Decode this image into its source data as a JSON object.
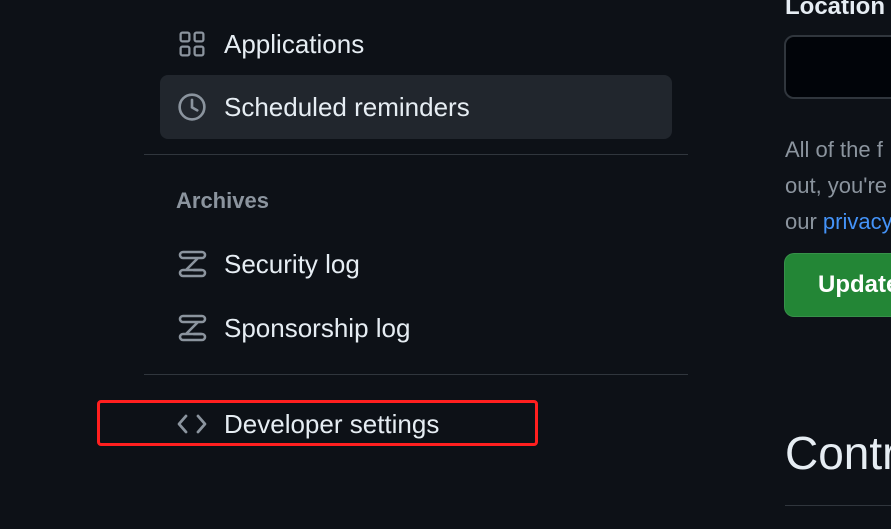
{
  "sidebar": {
    "items": [
      {
        "label": "Applications",
        "icon": "apps-grid-icon"
      },
      {
        "label": "Scheduled reminders",
        "icon": "clock-icon",
        "active": true
      }
    ],
    "archives": {
      "heading": "Archives",
      "items": [
        {
          "label": "Security log",
          "icon": "log-icon"
        },
        {
          "label": "Sponsorship log",
          "icon": "log-icon"
        }
      ]
    },
    "developer_settings": {
      "label": "Developer settings",
      "icon": "code-icon"
    }
  },
  "main": {
    "location_label": "Location",
    "location_value": "",
    "note": {
      "line1": "All of the f",
      "line2": "out, you're",
      "line3_prefix": "our ",
      "line3_link": "privacy"
    },
    "update_button_label": "Update",
    "contributions_heading": "Contri"
  },
  "colors": {
    "background": "#0d1117",
    "active_item": "#21262d",
    "divider": "#30363d",
    "muted_text": "#8b949e",
    "link": "#4493f8",
    "primary_button": "#238636",
    "highlight": "#ff1f1f"
  }
}
